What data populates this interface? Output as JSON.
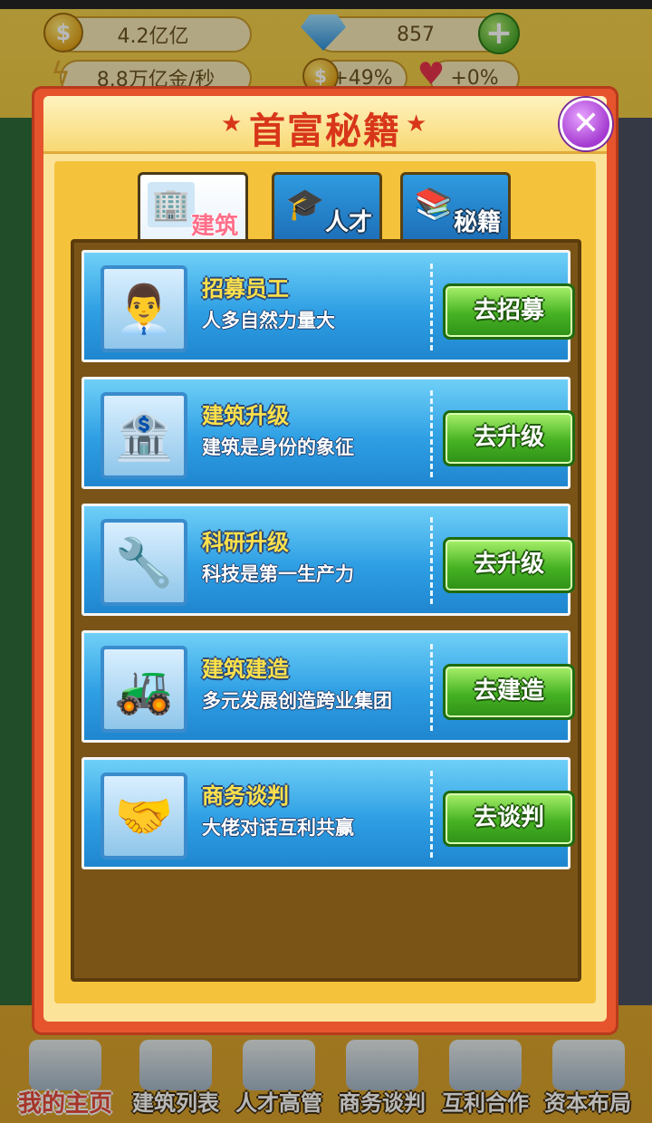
{
  "top_bar": {
    "coins_value": "4.2亿亿",
    "gems_value": "857",
    "income_rate": "8.8万亿金/秒",
    "coin_bonus": "+49%",
    "heart_bonus": "+0%",
    "coin_symbol": "$",
    "plus_symbol": "+"
  },
  "dialog": {
    "title": "首富秘籍",
    "close_symbol": "✕",
    "tabs": [
      {
        "label": "建筑",
        "icon": "building-icon",
        "glyph": "🏢",
        "active": true
      },
      {
        "label": "人才",
        "icon": "graduation-cap-icon",
        "glyph": "🎓",
        "active": false
      },
      {
        "label": "秘籍",
        "icon": "books-icon",
        "glyph": "📚",
        "active": false
      }
    ],
    "items": [
      {
        "title": "招募员工",
        "desc": "人多自然力量大",
        "button": "去招募",
        "icon": "manager-icon",
        "glyph": "👨‍💼"
      },
      {
        "title": "建筑升级",
        "desc": "建筑是身份的象征",
        "button": "去升级",
        "icon": "bank-upgrade-icon",
        "glyph": "🏦"
      },
      {
        "title": "科研升级",
        "desc": "科技是第一生产力",
        "button": "去升级",
        "icon": "wrench-upgrade-icon",
        "glyph": "🔧"
      },
      {
        "title": "建筑建造",
        "desc": "多元发展创造跨业集团",
        "button": "去建造",
        "icon": "excavator-icon",
        "glyph": "🚜"
      },
      {
        "title": "商务谈判",
        "desc": "大佬对话互利共赢",
        "button": "去谈判",
        "icon": "handshake-icon",
        "glyph": "🤝"
      }
    ]
  },
  "bottom_nav": [
    {
      "label": "我的主页",
      "active": true
    },
    {
      "label": "建筑列表",
      "active": false
    },
    {
      "label": "人才高管",
      "active": false
    },
    {
      "label": "商务谈判",
      "active": false
    },
    {
      "label": "互利合作",
      "active": false
    },
    {
      "label": "资本布局",
      "active": false
    }
  ],
  "colors": {
    "dialog_border": "#e6542e",
    "title_red": "#d8361a",
    "row_blue": "#2f9fe4",
    "button_green": "#46b223",
    "row_title_yellow": "#ffe14a"
  }
}
